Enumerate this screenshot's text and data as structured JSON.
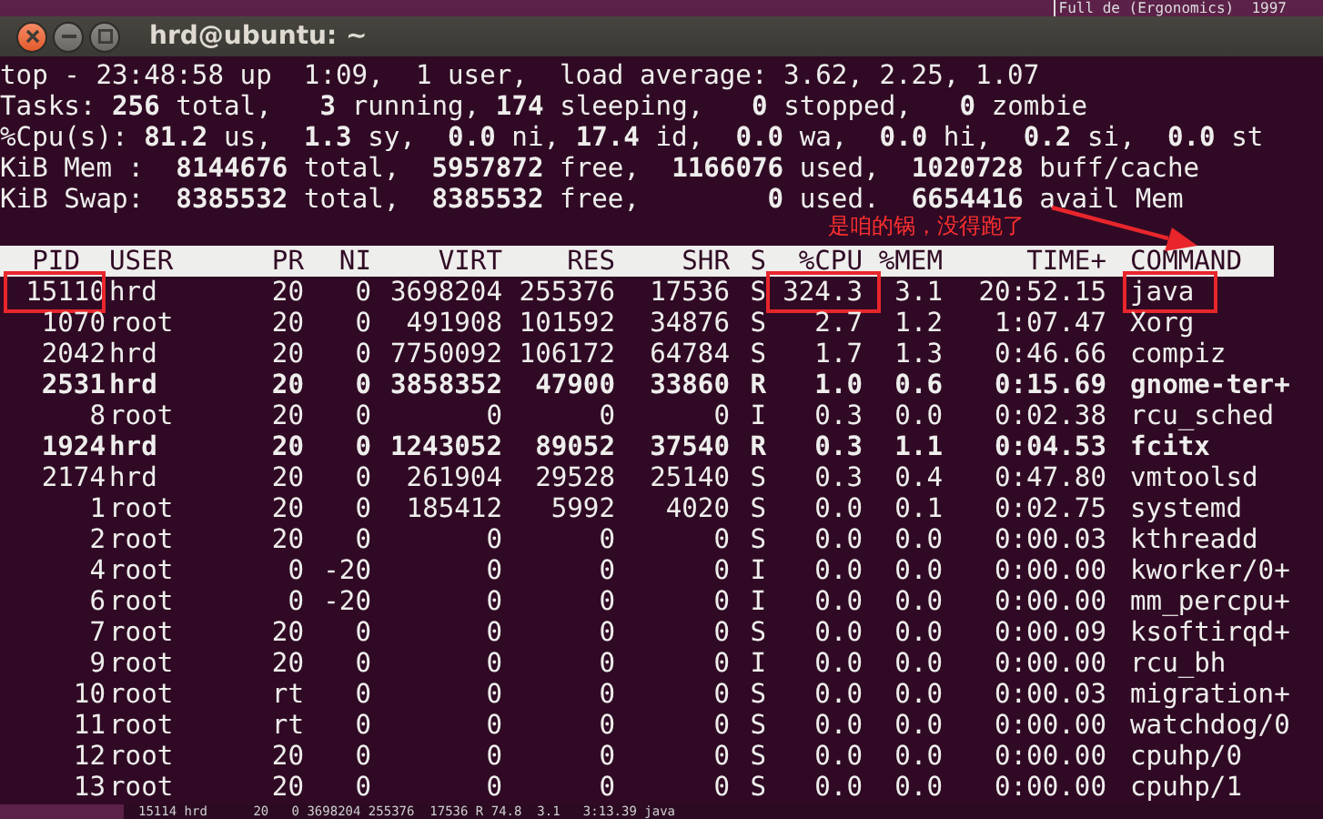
{
  "desktop": {
    "background_window_text": "Full de (Ergonomics)  1997"
  },
  "window": {
    "title": "hrd@ubuntu: ~"
  },
  "summary_lines": [
    "top - 23:48:58 up  1:09,  1 user,  load average: 3.62, 2.25, 1.07",
    "Tasks: **256** total,   **3** running, **174** sleeping,   **0** stopped,   **0** zombie",
    "%Cpu(s): **81.2** us,  **1.3** sy,  **0.0** ni, **17.4** id,  **0.0** wa,  **0.0** hi,  **0.2** si,  **0.0** st",
    "KiB Mem :  **8144676** total,  **5957872** free,  **1166076** used,  **1020728** buff/cache",
    "KiB Swap:  **8385532** total,  **8385532** free,        **0** used.  **6654416** avail Mem"
  ],
  "table": {
    "columns": [
      "PID",
      "USER",
      "PR",
      "NI",
      "VIRT",
      "RES",
      "SHR",
      "S",
      "%CPU",
      "%MEM",
      "TIME+",
      "COMMAND"
    ],
    "rows": [
      {
        "bold": false,
        "boxed": [
          true,
          false,
          false,
          false,
          false,
          false,
          false,
          false,
          true,
          false,
          false,
          true
        ],
        "cells": [
          "15110",
          "hrd",
          "20",
          "0",
          "3698204",
          "255376",
          "17536",
          "S",
          "324.3",
          "3.1",
          "20:52.15",
          "java"
        ]
      },
      {
        "bold": false,
        "cells": [
          "1070",
          "root",
          "20",
          "0",
          "491908",
          "101592",
          "34876",
          "S",
          "2.7",
          "1.2",
          "1:07.47",
          "Xorg"
        ]
      },
      {
        "bold": false,
        "cells": [
          "2042",
          "hrd",
          "20",
          "0",
          "7750092",
          "106172",
          "64784",
          "S",
          "1.7",
          "1.3",
          "0:46.66",
          "compiz"
        ]
      },
      {
        "bold": true,
        "cells": [
          "2531",
          "hrd",
          "20",
          "0",
          "3858352",
          "47900",
          "33860",
          "R",
          "1.0",
          "0.6",
          "0:15.69",
          "gnome-ter+"
        ]
      },
      {
        "bold": false,
        "cells": [
          "8",
          "root",
          "20",
          "0",
          "0",
          "0",
          "0",
          "I",
          "0.3",
          "0.0",
          "0:02.38",
          "rcu_sched"
        ]
      },
      {
        "bold": true,
        "cells": [
          "1924",
          "hrd",
          "20",
          "0",
          "1243052",
          "89052",
          "37540",
          "R",
          "0.3",
          "1.1",
          "0:04.53",
          "fcitx"
        ]
      },
      {
        "bold": false,
        "cells": [
          "2174",
          "hrd",
          "20",
          "0",
          "261904",
          "29528",
          "25140",
          "S",
          "0.3",
          "0.4",
          "0:47.80",
          "vmtoolsd"
        ]
      },
      {
        "bold": false,
        "cells": [
          "1",
          "root",
          "20",
          "0",
          "185412",
          "5992",
          "4020",
          "S",
          "0.0",
          "0.1",
          "0:02.75",
          "systemd"
        ]
      },
      {
        "bold": false,
        "cells": [
          "2",
          "root",
          "20",
          "0",
          "0",
          "0",
          "0",
          "S",
          "0.0",
          "0.0",
          "0:00.03",
          "kthreadd"
        ]
      },
      {
        "bold": false,
        "cells": [
          "4",
          "root",
          "0",
          "-20",
          "0",
          "0",
          "0",
          "I",
          "0.0",
          "0.0",
          "0:00.00",
          "kworker/0+"
        ]
      },
      {
        "bold": false,
        "cells": [
          "6",
          "root",
          "0",
          "-20",
          "0",
          "0",
          "0",
          "I",
          "0.0",
          "0.0",
          "0:00.00",
          "mm_percpu+"
        ]
      },
      {
        "bold": false,
        "cells": [
          "7",
          "root",
          "20",
          "0",
          "0",
          "0",
          "0",
          "S",
          "0.0",
          "0.0",
          "0:00.09",
          "ksoftirqd+"
        ]
      },
      {
        "bold": false,
        "cells": [
          "9",
          "root",
          "20",
          "0",
          "0",
          "0",
          "0",
          "I",
          "0.0",
          "0.0",
          "0:00.00",
          "rcu_bh"
        ]
      },
      {
        "bold": false,
        "cells": [
          "10",
          "root",
          "rt",
          "0",
          "0",
          "0",
          "0",
          "S",
          "0.0",
          "0.0",
          "0:00.03",
          "migration+"
        ]
      },
      {
        "bold": false,
        "cells": [
          "11",
          "root",
          "rt",
          "0",
          "0",
          "0",
          "0",
          "S",
          "0.0",
          "0.0",
          "0:00.00",
          "watchdog/0"
        ]
      },
      {
        "bold": false,
        "cells": [
          "12",
          "root",
          "20",
          "0",
          "0",
          "0",
          "0",
          "S",
          "0.0",
          "0.0",
          "0:00.00",
          "cpuhp/0"
        ]
      },
      {
        "bold": false,
        "cells": [
          "13",
          "root",
          "20",
          "0",
          "0",
          "0",
          "0",
          "S",
          "0.0",
          "0.0",
          "0:00.00",
          "cpuhp/1"
        ]
      }
    ]
  },
  "annotation": {
    "text": "是咱的锅，没得跑了",
    "arrow": true
  },
  "background_terminal_line": "15114 hrd      20   0 3698204 255376  17536 R 74.8  3.1   3:13.39 java"
}
